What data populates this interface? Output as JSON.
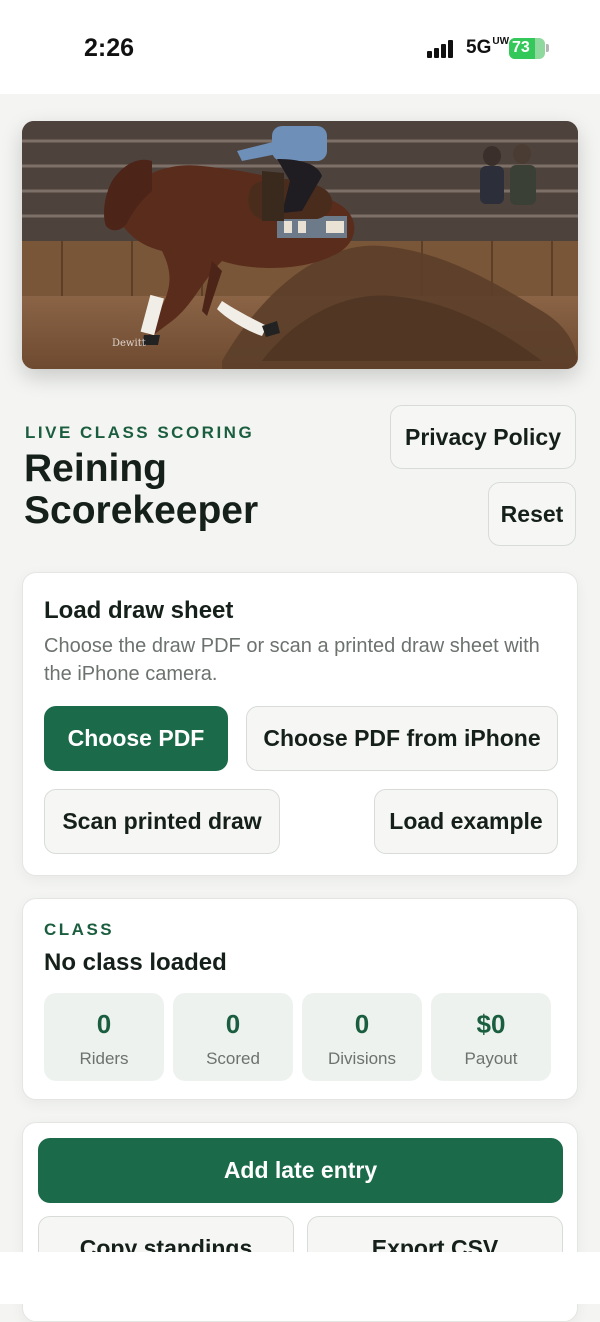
{
  "status_bar": {
    "time": "2:26",
    "network": "5G",
    "network_suffix": "UW",
    "battery": "73",
    "battery_level": 0.73,
    "battery_color": "#34c759"
  },
  "hero": {
    "watermark": "Dewitt"
  },
  "header": {
    "eyebrow": "LIVE CLASS SCORING",
    "title_line1": "Reining",
    "title_line2": "Scorekeeper",
    "privacy_label": "Privacy Policy",
    "reset_label": "Reset"
  },
  "draw_card": {
    "title": "Load draw sheet",
    "description": "Choose the draw PDF or scan a printed draw sheet with the iPhone camera.",
    "choose_pdf": "Choose PDF",
    "choose_pdf_iphone": "Choose PDF from iPhone",
    "scan_draw": "Scan printed draw",
    "load_example": "Load example"
  },
  "class_card": {
    "eyebrow": "CLASS",
    "status": "No class loaded",
    "stats": [
      {
        "value": "0",
        "label": "Riders"
      },
      {
        "value": "0",
        "label": "Scored"
      },
      {
        "value": "0",
        "label": "Divisions"
      },
      {
        "value": "$0",
        "label": "Payout"
      }
    ]
  },
  "actions": {
    "add_late_entry": "Add late entry",
    "copy_standings": "Copy standings",
    "export_csv": "Export CSV"
  },
  "colors": {
    "accent": "#1b6b4a",
    "accent_text": "#1b5e3f",
    "background": "#f4f5f3"
  }
}
